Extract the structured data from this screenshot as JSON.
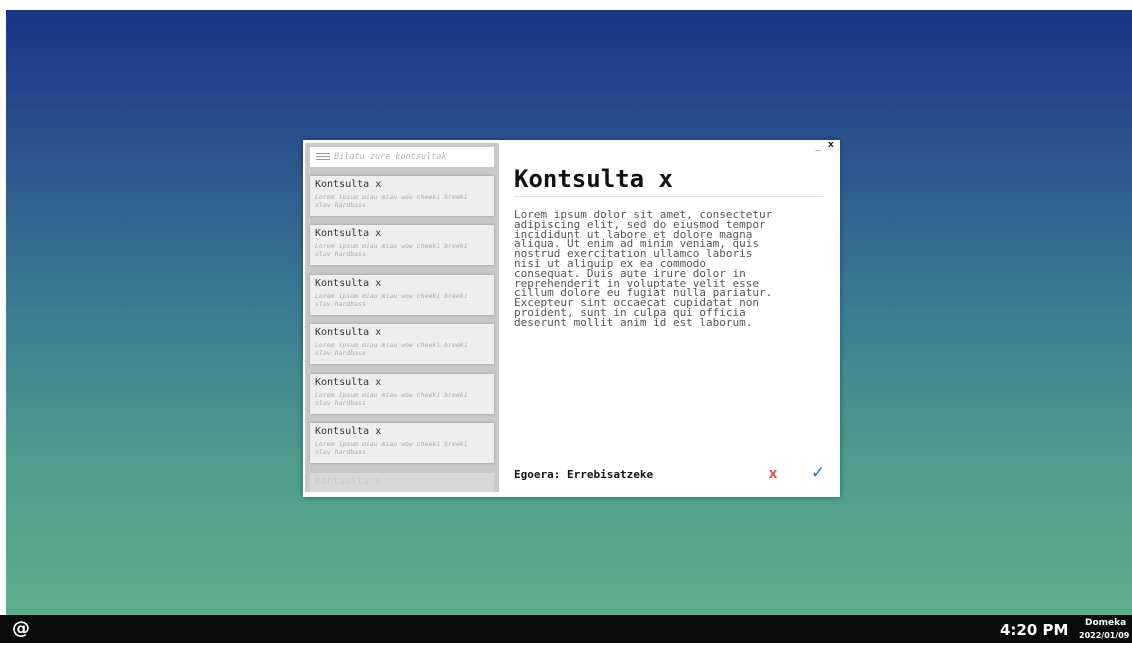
{
  "window": {
    "minimize_label": "_",
    "close_label": "x"
  },
  "sidebar": {
    "search_placeholder": "Bilatu zure kontsultak",
    "items": [
      {
        "title": "Kontsulta x",
        "snippet": "Lorem ipsum miau miau wow cheeki breeki slav hardbass"
      },
      {
        "title": "Kontsulta x",
        "snippet": "Lorem ipsum miau miau wow cheeki breeki slav hardbass"
      },
      {
        "title": "Kontsulta x",
        "snippet": "Lorem ipsum miau miau wow cheeki breeki slav hardbass"
      },
      {
        "title": "Kontsulta x",
        "snippet": "Lorem ipsum miau miau wow cheeki breeki slav hardbass"
      },
      {
        "title": "Kontsulta x",
        "snippet": "Lorem ipsum miau miau wow cheeki breeki slav hardbass"
      },
      {
        "title": "Kontsulta x",
        "snippet": "Lorem ipsum miau miau wow cheeki breeki slav hardbass"
      },
      {
        "title": "Kontsulta x",
        "snippet": ""
      }
    ]
  },
  "detail": {
    "title": "Kontsulta x",
    "body": "Lorem ipsum dolor sit amet, consectetur\nadipiscing elit, sed do eiusmod tempor\nincididunt ut labore et dolore magna\naliqua. Ut enim ad minim veniam, quis\nnostrud exercitation ullamco laboris\nnisi ut aliquip ex ea commodo\nconsequat. Duis aute irure dolor in\nreprehenderit in voluptate velit esse\ncillum dolore eu fugiat nulla pariatur.\nExcepteur sint occaecat cupidatat non\nproident, sunt in culpa qui officia\ndeserunt mollit anim id est laborum.",
    "state": "Egoera: Errebisatzeke",
    "reject_label": "x",
    "accept_label": "✓"
  },
  "taskbar": {
    "start_label": "@",
    "time": "4:20 PM",
    "day": "Domeka",
    "date": "2022/01/09"
  },
  "colors": {
    "reject": "#e35a5a",
    "accept": "#2c72c8",
    "desktop_top": "#1b3486",
    "desktop_bottom": "#5cae8b",
    "taskbar": "#0b0b0b"
  }
}
